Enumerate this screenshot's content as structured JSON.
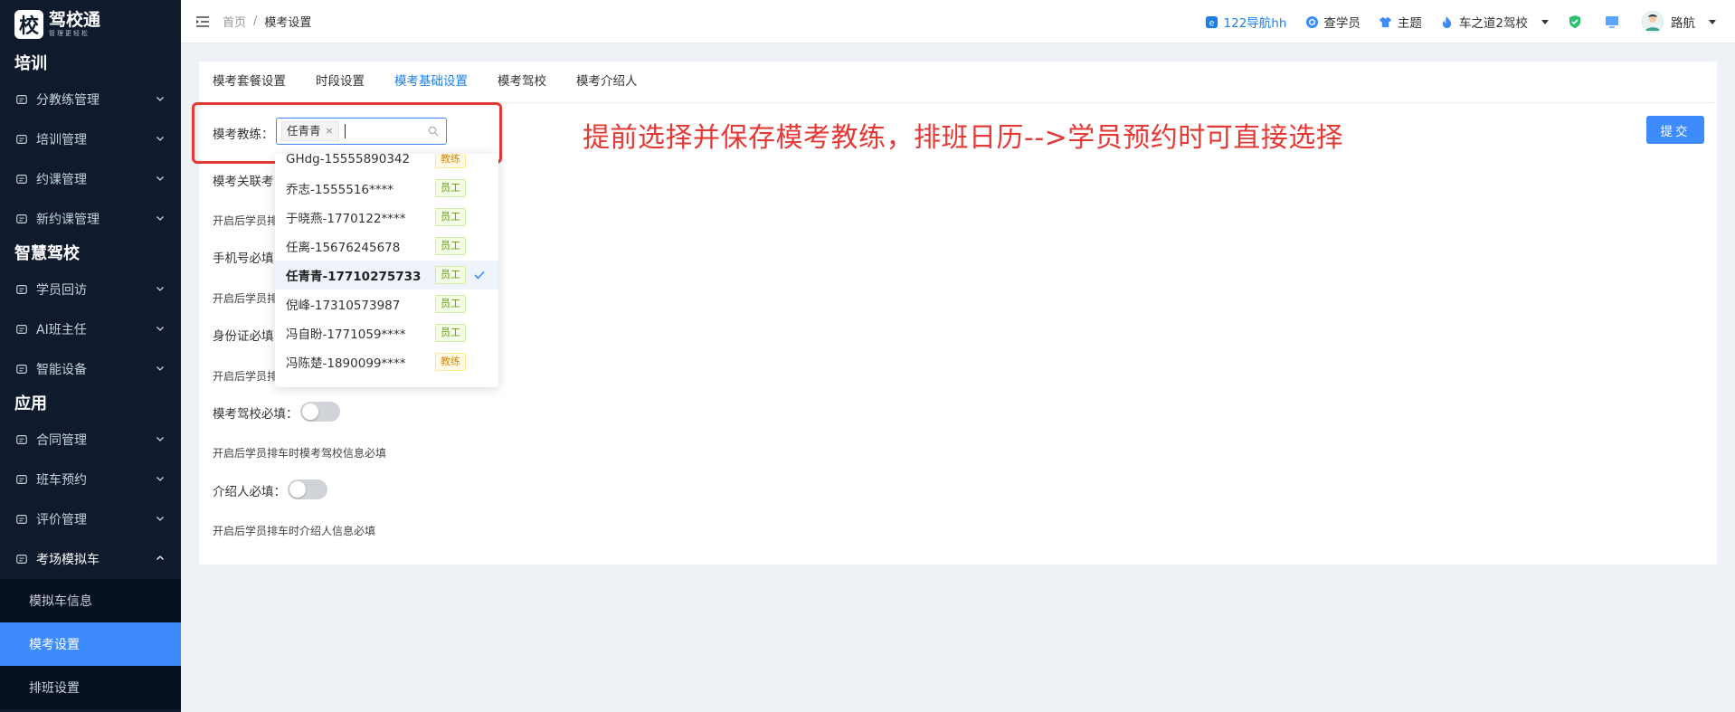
{
  "app": {
    "logo_char": "校",
    "logo_title": "驾校通",
    "logo_sub": "管理更轻松"
  },
  "sidebar": {
    "sections": [
      {
        "title": "培训",
        "items": [
          {
            "label": "分教练管理",
            "icon": "chart-icon"
          },
          {
            "label": "培训管理",
            "icon": "chat-icon"
          },
          {
            "label": "约课管理",
            "icon": "calendar-icon"
          },
          {
            "label": "新约课管理",
            "icon": "calendar-icon"
          }
        ]
      },
      {
        "title": "智慧驾校",
        "items": [
          {
            "label": "学员回访",
            "icon": "phone-icon"
          },
          {
            "label": "AI班主任",
            "icon": "headset-icon"
          },
          {
            "label": "智能设备",
            "icon": "device-icon"
          }
        ]
      },
      {
        "title": "应用",
        "items": [
          {
            "label": "合同管理",
            "icon": "contract-icon"
          },
          {
            "label": "班车预约",
            "icon": "bus-icon"
          },
          {
            "label": "评价管理",
            "icon": "comment-icon"
          },
          {
            "label": "考场模拟车",
            "icon": "car-icon",
            "open": true
          }
        ]
      }
    ],
    "sub_items": [
      {
        "label": "模拟车信息",
        "active": false
      },
      {
        "label": "模考设置",
        "active": true
      },
      {
        "label": "排班设置",
        "active": false
      }
    ]
  },
  "header": {
    "breadcrumb_home": "首页",
    "breadcrumb_sep": "/",
    "breadcrumb_current": "模考设置",
    "nav_link": "122导航hh",
    "search_student": "查学员",
    "theme": "主题",
    "school": "车之道2驾校",
    "user": "路航",
    "accent": "#1e7fe6"
  },
  "tabs": [
    "模考套餐设置",
    "时段设置",
    "模考基础设置",
    "模考驾校",
    "模考介绍人"
  ],
  "active_tab": 2,
  "form": {
    "coach_label": "模考教练：",
    "selected_tag": "任青青",
    "tag_close": "×",
    "related_label": "模考关联考",
    "hint1": "开启后学员排",
    "phone_label": "手机号必填",
    "hint2": "开启后学员排",
    "id_label": "身份证必填",
    "hint3": "开启后学员排",
    "school_label": "模考驾校必填：",
    "school_hint": "开启后学员排车时模考驾校信息必填",
    "referrer_label": "介绍人必填：",
    "referrer_hint": "开启后学员排车时介绍人信息必填",
    "submit": "提交"
  },
  "annotation": "提前选择并保存模考教练，排班日历-->学员预约时可直接选择",
  "dropdown": [
    {
      "name": "GHdg-15555890342",
      "role": "教练",
      "type": "coach",
      "selected": false
    },
    {
      "name": "乔志-1555516****",
      "role": "员工",
      "type": "staff",
      "selected": false
    },
    {
      "name": "于晓燕-1770122****",
      "role": "员工",
      "type": "staff",
      "selected": false
    },
    {
      "name": "任离-15676245678",
      "role": "员工",
      "type": "staff",
      "selected": false
    },
    {
      "name": "任青青-17710275733",
      "role": "员工",
      "type": "staff",
      "selected": true
    },
    {
      "name": "倪峰-17310573987",
      "role": "员工",
      "type": "staff",
      "selected": false
    },
    {
      "name": "冯自盼-1771059****",
      "role": "员工",
      "type": "staff",
      "selected": false
    },
    {
      "name": "冯陈楚-1890099****",
      "role": "教练",
      "type": "coach",
      "selected": false
    }
  ]
}
